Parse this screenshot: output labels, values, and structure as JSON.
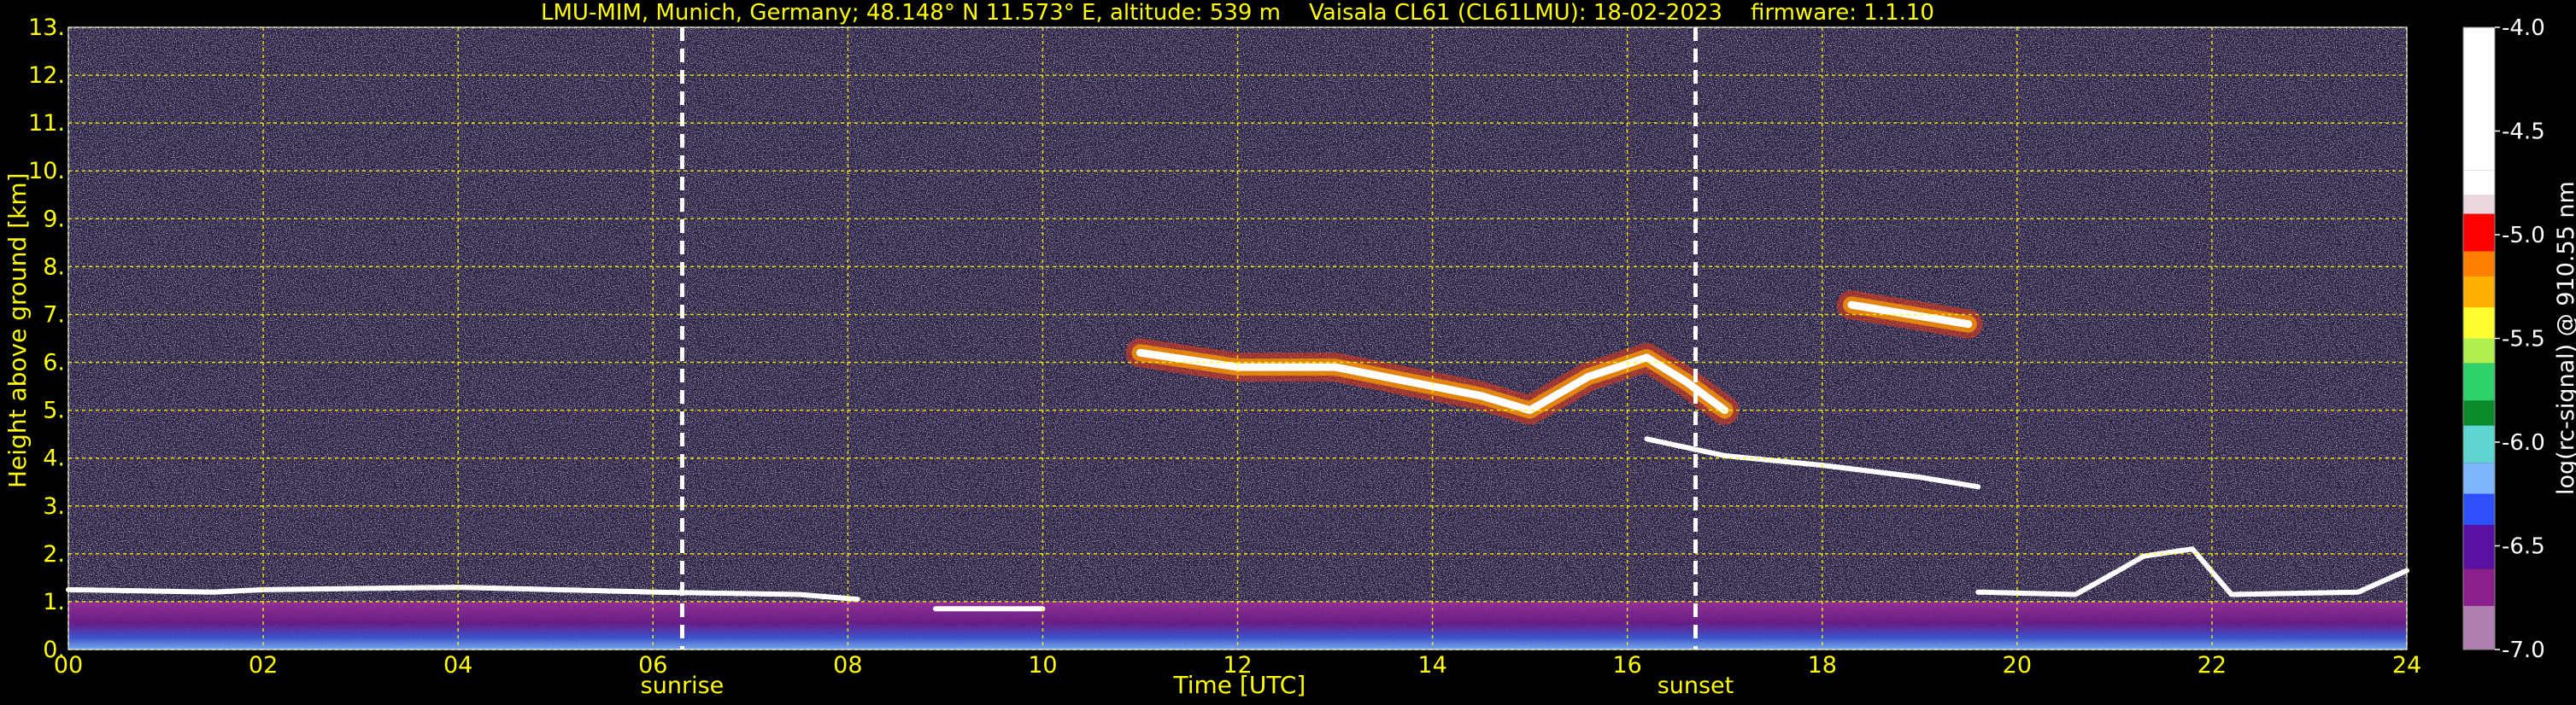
{
  "title": "LMU-MIM, Munich, Germany; 48.148° N 11.573° E, altitude: 539 m    Vaisala CL61 (CL61LMU): 18-02-2023    firmware: 1.1.10",
  "colors": {
    "text": "#ffff00",
    "grid": "#ffff00",
    "background": "#000000",
    "colorbar_text": "#ffffff"
  },
  "chart_data": {
    "type": "heatmap",
    "title": "LMU-MIM, Munich, Germany; 48.148° N 11.573° E, altitude: 539 m    Vaisala CL61 (CL61LMU): 18-02-2023    firmware: 1.1.10",
    "xlabel": "Time [UTC]",
    "ylabel": "Height above ground [km]",
    "xlim": [
      0,
      24
    ],
    "ylim": [
      0,
      13
    ],
    "x_ticks": [
      "00",
      "02",
      "04",
      "06",
      "08",
      "10",
      "12",
      "14",
      "16",
      "18",
      "20",
      "22",
      "24"
    ],
    "y_ticks": [
      "0.",
      "1.",
      "2.",
      "3.",
      "4.",
      "5.",
      "6.",
      "7.",
      "8.",
      "9.",
      "10.",
      "11.",
      "12.",
      "13."
    ],
    "grid": true,
    "annotations": [
      {
        "label": "sunrise",
        "x": 6.3
      },
      {
        "label": "sunset",
        "x": 16.7
      }
    ],
    "colorbar": {
      "label": "log(rc-signal) @ 910.55 nm",
      "range": [
        -7.0,
        -4.0
      ],
      "ticks": [
        "-4.0",
        "-4.5",
        "-5.0",
        "-5.5",
        "-6.0",
        "-6.5",
        "-7.0"
      ]
    },
    "features": [
      {
        "type": "boundary_layer_top",
        "points": [
          [
            0,
            1.25
          ],
          [
            1.5,
            1.2
          ],
          [
            2,
            1.25
          ],
          [
            4,
            1.3
          ],
          [
            6,
            1.2
          ],
          [
            7.5,
            1.15
          ],
          [
            8.1,
            1.05
          ]
        ]
      },
      {
        "type": "boundary_layer_top",
        "points": [
          [
            8.9,
            0.85
          ],
          [
            10,
            0.85
          ]
        ]
      },
      {
        "type": "boundary_layer_top",
        "points": [
          [
            19.6,
            1.2
          ],
          [
            20.6,
            1.15
          ],
          [
            21,
            1.6
          ],
          [
            21.3,
            1.95
          ],
          [
            21.8,
            2.1
          ],
          [
            22.2,
            1.15
          ],
          [
            23.5,
            1.2
          ],
          [
            24,
            1.65
          ]
        ]
      },
      {
        "type": "mid_cloud",
        "points": [
          [
            11,
            6.2
          ],
          [
            12,
            5.9
          ],
          [
            13,
            5.9
          ],
          [
            14,
            5.5
          ],
          [
            14.5,
            5.3
          ],
          [
            15,
            5.0
          ],
          [
            15.6,
            5.7
          ],
          [
            16.2,
            6.1
          ],
          [
            16.6,
            5.6
          ],
          [
            17,
            5.0
          ]
        ]
      },
      {
        "type": "descending_layer",
        "points": [
          [
            16.2,
            4.4
          ],
          [
            17,
            4.05
          ],
          [
            18,
            3.85
          ],
          [
            19,
            3.6
          ],
          [
            19.6,
            3.4
          ]
        ]
      },
      {
        "type": "cloud_patch",
        "points": [
          [
            18.3,
            7.2
          ],
          [
            19.5,
            6.8
          ]
        ]
      }
    ]
  }
}
